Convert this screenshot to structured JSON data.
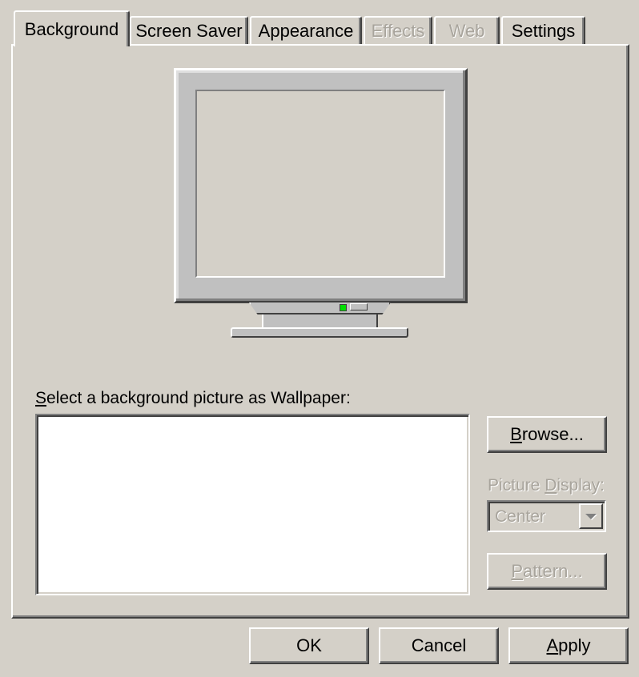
{
  "tabs": [
    {
      "label": "Background",
      "state": "active"
    },
    {
      "label": "Screen Saver",
      "state": "normal"
    },
    {
      "label": "Appearance",
      "state": "normal"
    },
    {
      "label": "Effects",
      "state": "disabled"
    },
    {
      "label": "Web",
      "state": "disabled"
    },
    {
      "label": "Settings",
      "state": "normal"
    }
  ],
  "wallpaper": {
    "label_mnemonic": "S",
    "label_rest": "elect a background picture as Wallpaper:",
    "items": []
  },
  "browse_button": {
    "mnemonic": "B",
    "rest": "rowse..."
  },
  "picture_display": {
    "label_pre": "Picture ",
    "label_mnemonic": "D",
    "label_post": "isplay:",
    "selected": "Center",
    "enabled": false
  },
  "pattern_button": {
    "mnemonic": "P",
    "rest": "attern...",
    "enabled": false
  },
  "footer": {
    "ok_label": "OK",
    "cancel_label": "Cancel",
    "apply_mnemonic": "A",
    "apply_rest": "pply"
  },
  "icons": {
    "dropdown": "chevron-down-icon",
    "monitor": "monitor-icon"
  },
  "colors": {
    "face": "#d4d0c8",
    "disabled_text": "#a8a49c",
    "led": "#00e000"
  }
}
